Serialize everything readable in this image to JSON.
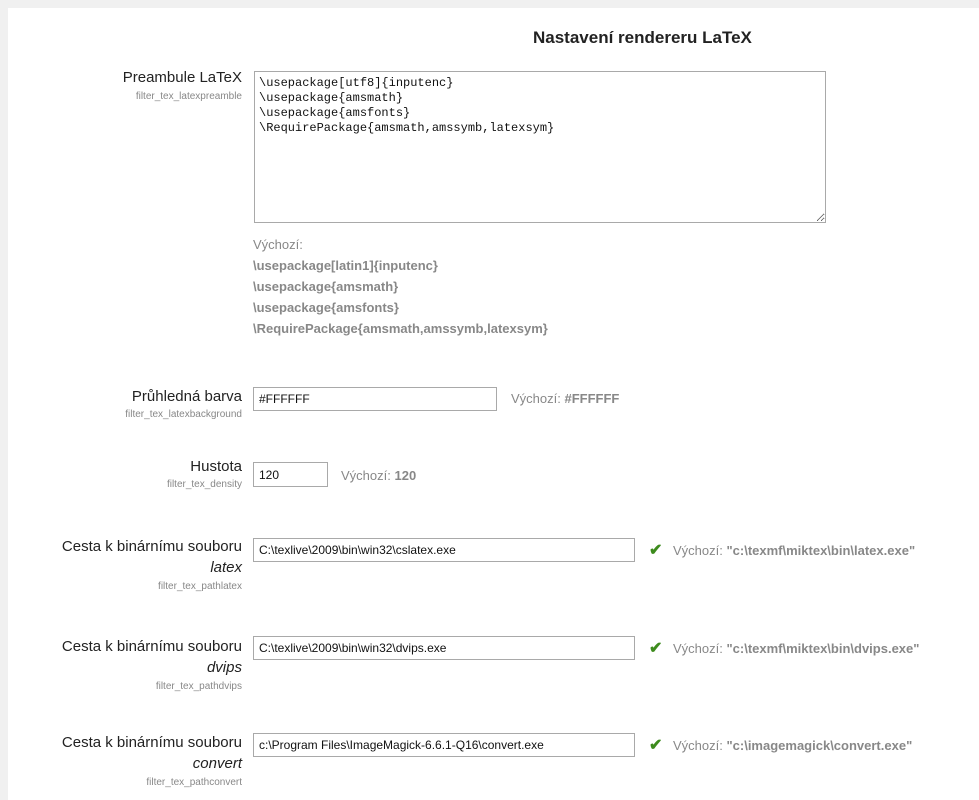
{
  "section_title": "Nastavení rendereru LaTeX",
  "preamble": {
    "label": "Preambule LaTeX",
    "setting_name": "filter_tex_latexpreamble",
    "value": "\\usepackage[utf8]{inputenc}\n\\usepackage{amsmath}\n\\usepackage{amsfonts}\n\\RequirePackage{amsmath,amssymb,latexsym}",
    "default_label": "Výchozí:",
    "default_value": "\\usepackage[latin1]{inputenc}\n\\usepackage{amsmath}\n\\usepackage{amsfonts}\n\\RequirePackage{amsmath,amssymb,latexsym}"
  },
  "background": {
    "label": "Průhledná barva",
    "setting_name": "filter_tex_latexbackground",
    "value": "#FFFFFF",
    "default_label": "Výchozí:",
    "default_value": "#FFFFFF"
  },
  "density": {
    "label": "Hustota",
    "setting_name": "filter_tex_density",
    "value": "120",
    "default_label": "Výchozí:",
    "default_value": "120"
  },
  "pathlatex": {
    "label": "Cesta k binárnímu souboru",
    "binary": "latex",
    "setting_name": "filter_tex_pathlatex",
    "value": "C:\\texlive\\2009\\bin\\win32\\cslatex.exe",
    "default_label": "Výchozí:",
    "default_value": "\"c:\\texmf\\miktex\\bin\\latex.exe\""
  },
  "pathdvips": {
    "label": "Cesta k binárnímu souboru",
    "binary": "dvips",
    "setting_name": "filter_tex_pathdvips",
    "value": "C:\\texlive\\2009\\bin\\win32\\dvips.exe",
    "default_label": "Výchozí:",
    "default_value": "\"c:\\texmf\\miktex\\bin\\dvips.exe\""
  },
  "pathconvert": {
    "label": "Cesta k binárnímu souboru",
    "binary": "convert",
    "setting_name": "filter_tex_pathconvert",
    "value": "c:\\Program Files\\ImageMagick-6.6.1-Q16\\convert.exe",
    "default_label": "Výchozí:",
    "default_value": "\"c:\\imagemagick\\convert.exe\""
  },
  "valid_icon": "check-icon",
  "colors": {
    "valid": "#3d8b1d",
    "muted": "#888888"
  }
}
